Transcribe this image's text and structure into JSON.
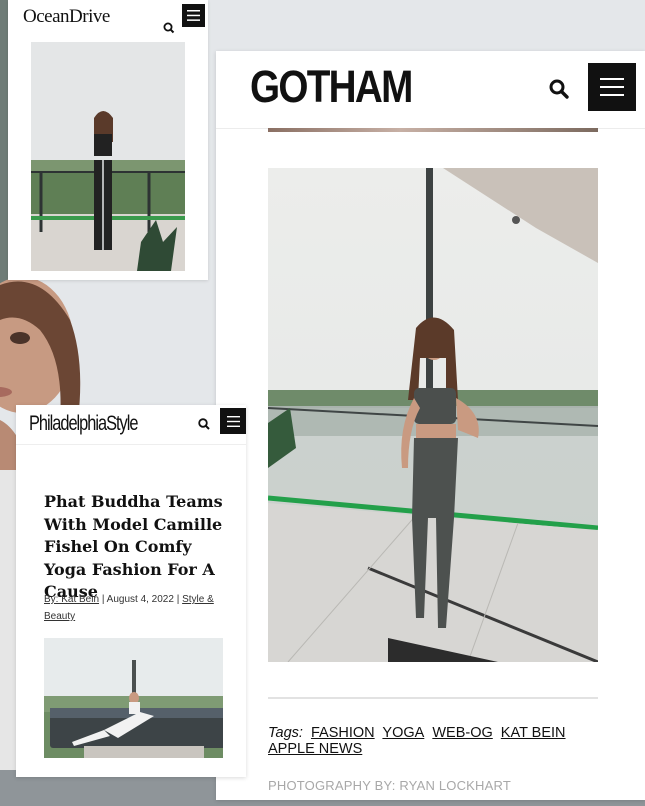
{
  "ocean_drive": {
    "logo": "OceanDrive"
  },
  "gotham": {
    "logo": "GOTHAM",
    "tags_label": "Tags:",
    "tags": [
      "FASHION",
      "YOGA",
      "WEB-OG",
      "KAT BEIN",
      "APPLE NEWS"
    ],
    "photo_credit": "PHOTOGRAPHY BY: RYAN LOCKHART"
  },
  "philadelphia_style": {
    "logo": "PhiladelphiaStyle",
    "headline": "Phat Buddha Teams With Model Camille Fishel On Comfy Yoga Fashion For A Cause",
    "byline": "By: Kat Bein",
    "separator": "|",
    "date": "August 4, 2022",
    "category": "Style & Beauty"
  },
  "icons": {
    "search": "search-icon",
    "menu": "hamburger-menu-icon"
  },
  "colors": {
    "header_button_bg": "#111111",
    "credit_text": "#a8a8a8"
  }
}
